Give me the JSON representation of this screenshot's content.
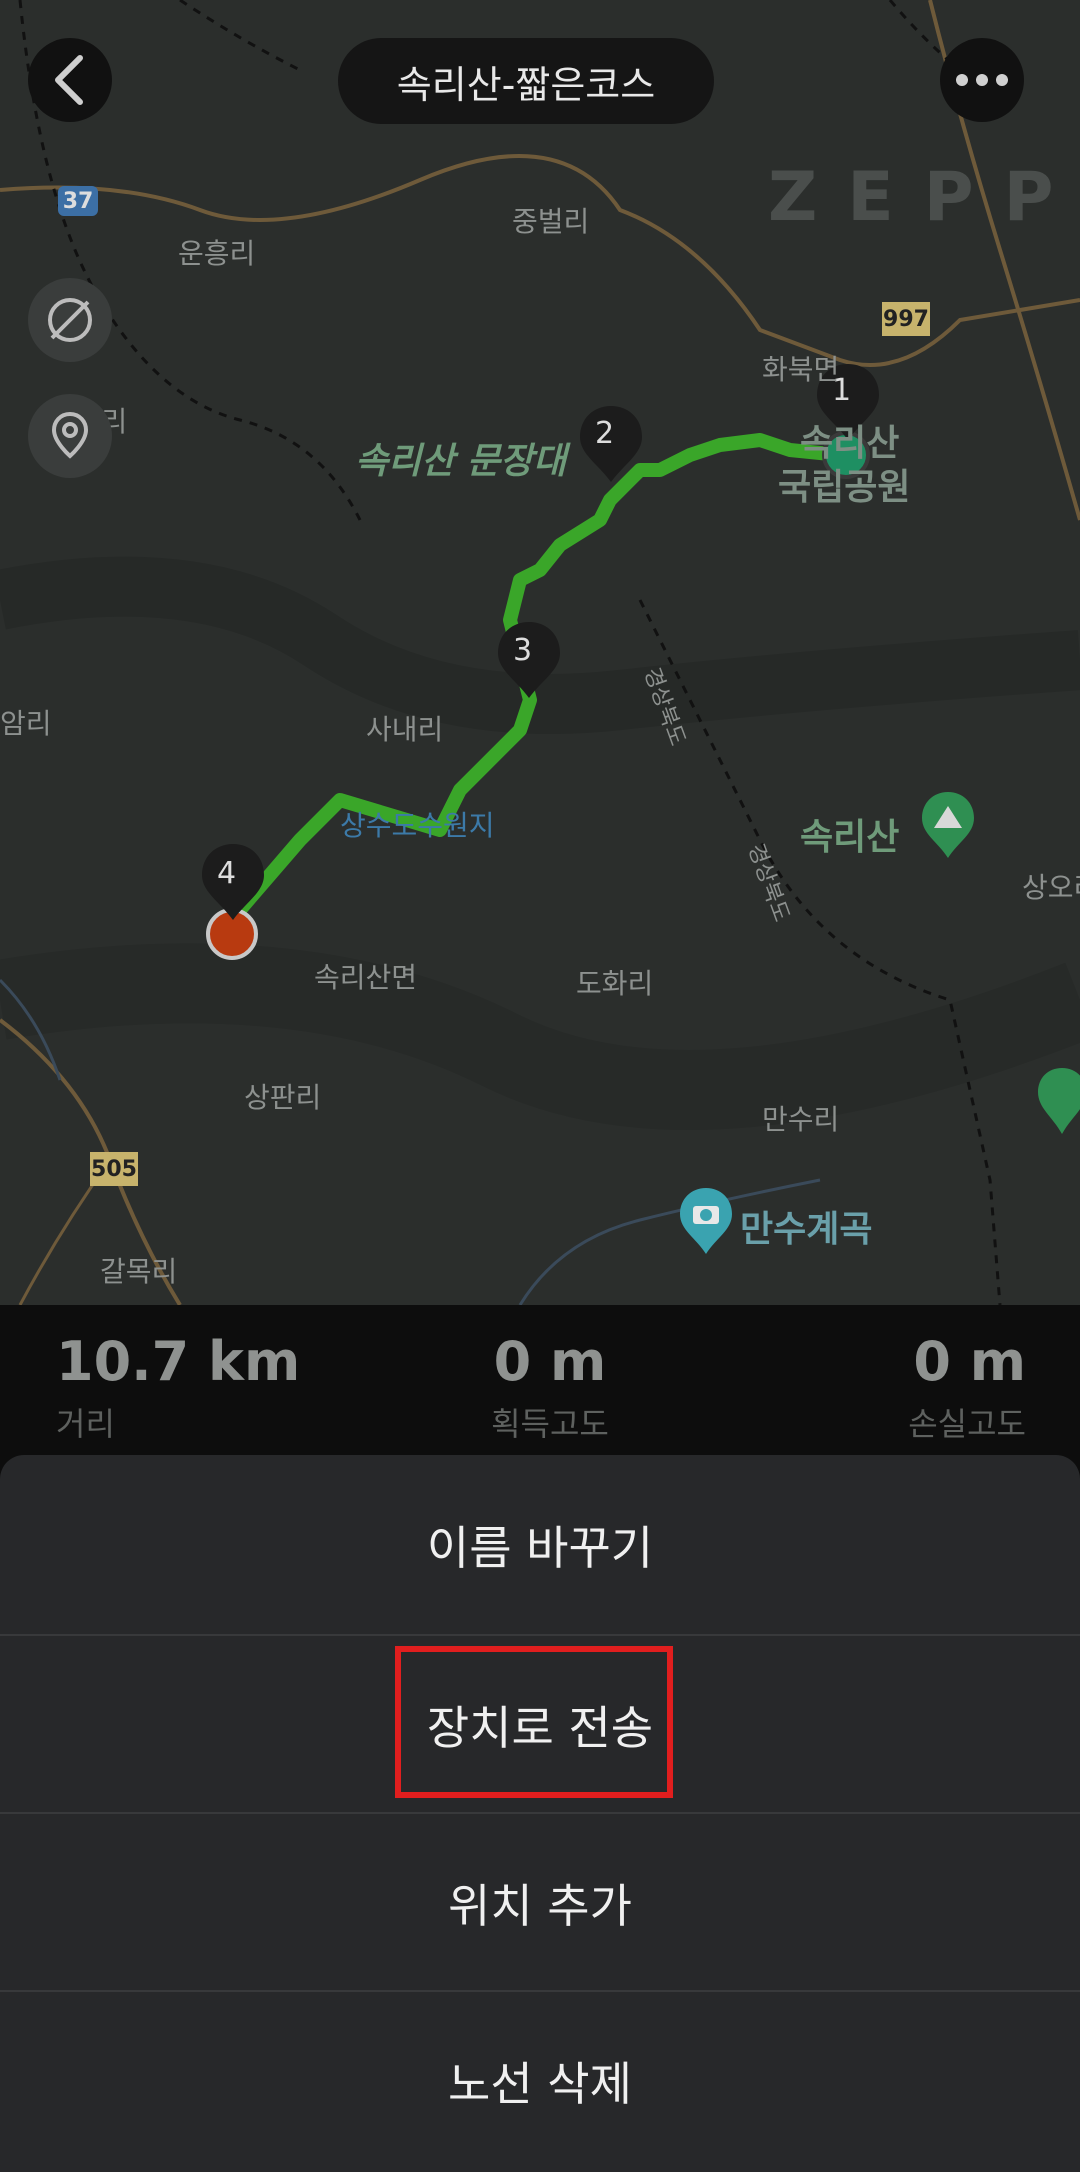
{
  "header": {
    "title": "속리산-짧은코스",
    "back_icon": "chevron-left-icon",
    "more_icon": "more-horizontal-icon"
  },
  "map": {
    "watermark": "ZEPP",
    "places": {
      "junbeolli": "중벌리",
      "unheungri": "운흥리",
      "hwabukmyeon": "화북면",
      "sajeongri": "사정리",
      "munjangdae": "속리산 문장대",
      "national_park_line1": "속리산",
      "national_park_line2": "국립공원",
      "amri": "암리",
      "sanaeri": "사내리",
      "sangsu_park": "상수도수원지",
      "songnisan_peak": "속리산",
      "sangori": "상오리",
      "songnisanmyeon": "속리산면",
      "dohwari": "도화리",
      "sangpanri": "상판리",
      "mansuri": "만수리",
      "mansu_valley": "만수계곡",
      "galmokri": "갈목리",
      "road1": "경상북도",
      "road2": "경상북도"
    },
    "road_numbers": {
      "r37": "37",
      "r997": "997",
      "r505": "505"
    },
    "waypoints": [
      "1",
      "2",
      "3",
      "4"
    ],
    "route_color": "#3aa629",
    "start_color": "#1e8f62",
    "end_color": "#b83a10"
  },
  "stats": [
    {
      "value": "10.7 km",
      "label": "거리"
    },
    {
      "value": "0 m",
      "label": "획득고도"
    },
    {
      "value": "0 m",
      "label": "손실고도"
    }
  ],
  "menu": {
    "rename": "이름 바꾸기",
    "send_to_device": "장치로 전송",
    "add_location": "위치 추가",
    "delete_route": "노선 삭제"
  }
}
